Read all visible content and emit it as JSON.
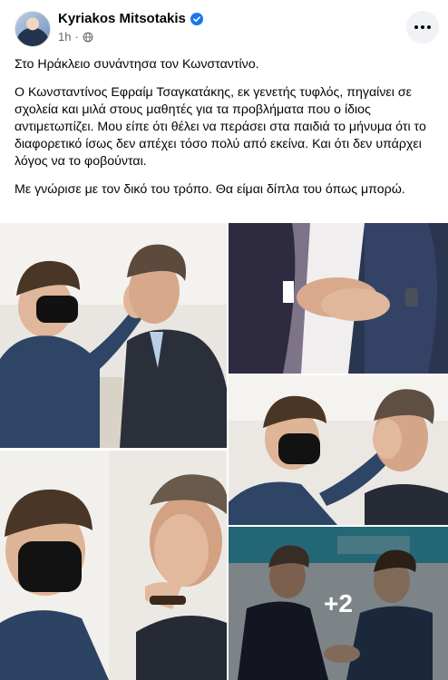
{
  "post": {
    "author": "Kyriakos Mitsotakis",
    "verified": true,
    "timestamp": "1h",
    "separator": "·",
    "privacy_icon": "globe-icon",
    "more_icon": "more-options-icon",
    "paragraphs": [
      "Στο Ηράκλειο συνάντησα τον Κωνσταντίνο.",
      "Ο Κωνσταντίνος Εφραίμ Τσαγκατάκης, εκ γενετής τυφλός, πηγαίνει σε σχολεία και μιλά στους μαθητές για τα προβλήματα που ο ίδιος αντιμετωπίζει. Μου είπε ότι θέλει να περάσει στα παιδιά το μήνυμα ότι το διαφορετικό ίσως δεν απέχει τόσο πολύ από εκείνα. Και ότι δεν υπάρχει λόγος να το φοβούνται.",
      "Με γνώρισε με τον δικό του τρόπο. Θα είμαι δίπλα του όπως μπορώ."
    ],
    "photos": {
      "more_count": "+2"
    }
  },
  "colors": {
    "verified_blue": "#1877f2",
    "meta_gray": "#65676b",
    "button_bg": "#f0f2f5"
  }
}
